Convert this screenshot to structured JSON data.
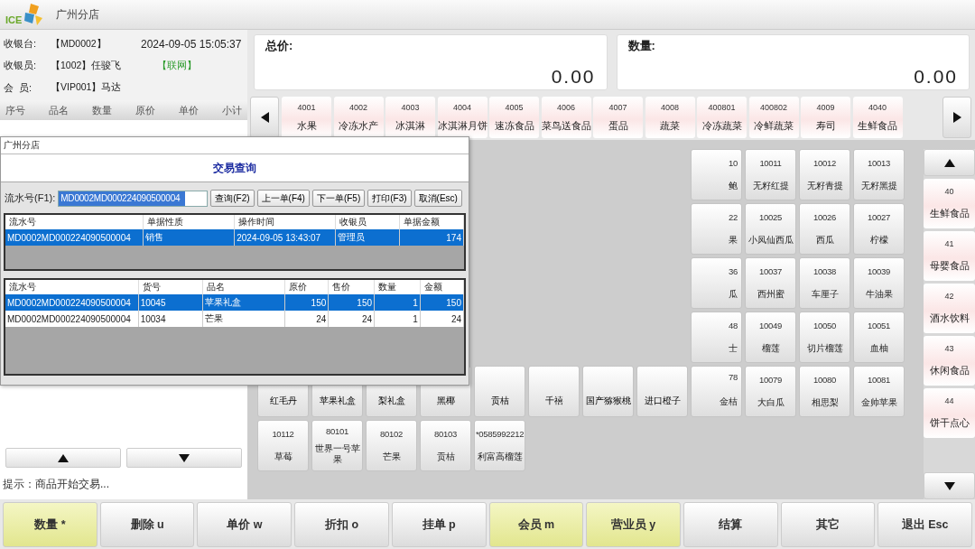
{
  "app": {
    "logo_text": "ICE",
    "store": "广州分店"
  },
  "info": {
    "register_label": "收银台:",
    "register": "【MD0002】",
    "datetime": "2024-09-05 15:05:37",
    "cashier_label": "收银员:",
    "cashier": "【1002】任骏飞",
    "network": "【联网】",
    "member_label": "会  员:",
    "member": "【VIP001】马达"
  },
  "cart_columns": [
    "序号",
    "品名",
    "数量",
    "原价",
    "单价",
    "小计"
  ],
  "hint": "提示：商品开始交易...",
  "totals": [
    {
      "label": "总价:",
      "value": "0.00"
    },
    {
      "label": "数量:",
      "value": "0.00"
    }
  ],
  "categories": [
    {
      "code": "4001",
      "name": "水果"
    },
    {
      "code": "4002",
      "name": "冷冻水产"
    },
    {
      "code": "4003",
      "name": "冰淇淋"
    },
    {
      "code": "4004",
      "name": "冰淇淋月饼"
    },
    {
      "code": "4005",
      "name": "速冻食品"
    },
    {
      "code": "4006",
      "name": "菜鸟送食品"
    },
    {
      "code": "4007",
      "name": "蛋品"
    },
    {
      "code": "4008",
      "name": "蔬菜"
    },
    {
      "code": "400801",
      "name": "冷冻蔬菜"
    },
    {
      "code": "400802",
      "name": "冷鲜蔬菜"
    },
    {
      "code": "4009",
      "name": "寿司"
    },
    {
      "code": "4040",
      "name": "生鲜食品"
    }
  ],
  "side_categories": [
    {
      "code": "40",
      "name": "生鲜食品"
    },
    {
      "code": "41",
      "name": "母婴食品"
    },
    {
      "code": "42",
      "name": "酒水饮料"
    },
    {
      "code": "43",
      "name": "休闲食品"
    },
    {
      "code": "44",
      "name": "饼干点心"
    }
  ],
  "product_rows": [
    [
      {
        "kind": "hidden"
      },
      {
        "kind": "hidden"
      },
      {
        "kind": "hidden"
      },
      {
        "kind": "hidden"
      },
      {
        "kind": "hidden"
      },
      {
        "kind": "hidden"
      },
      {
        "kind": "hidden"
      },
      {
        "kind": "hidden"
      },
      {
        "kind": "partial",
        "code": "10",
        "name": "鲍"
      },
      {
        "kind": "full",
        "code": "10011",
        "name": "无籽红提"
      },
      {
        "kind": "full",
        "code": "10012",
        "name": "无籽青提"
      },
      {
        "kind": "full",
        "code": "10013",
        "name": "无籽黑提"
      }
    ],
    [
      {
        "kind": "hidden"
      },
      {
        "kind": "hidden"
      },
      {
        "kind": "hidden"
      },
      {
        "kind": "hidden"
      },
      {
        "kind": "hidden"
      },
      {
        "kind": "hidden"
      },
      {
        "kind": "hidden"
      },
      {
        "kind": "hidden"
      },
      {
        "kind": "partial",
        "code": "22",
        "name": "果"
      },
      {
        "kind": "full",
        "code": "10025",
        "name": "小凤仙西瓜"
      },
      {
        "kind": "full",
        "code": "10026",
        "name": "西瓜"
      },
      {
        "kind": "full",
        "code": "10027",
        "name": "柠檬"
      }
    ],
    [
      {
        "kind": "hidden"
      },
      {
        "kind": "hidden"
      },
      {
        "kind": "hidden"
      },
      {
        "kind": "hidden"
      },
      {
        "kind": "hidden"
      },
      {
        "kind": "hidden"
      },
      {
        "kind": "hidden"
      },
      {
        "kind": "hidden"
      },
      {
        "kind": "partial",
        "code": "36",
        "name": "瓜"
      },
      {
        "kind": "full",
        "code": "10037",
        "name": "西州蜜"
      },
      {
        "kind": "full",
        "code": "10038",
        "name": "车厘子"
      },
      {
        "kind": "full",
        "code": "10039",
        "name": "牛油果"
      }
    ],
    [
      {
        "kind": "hidden"
      },
      {
        "kind": "hidden"
      },
      {
        "kind": "hidden"
      },
      {
        "kind": "hidden"
      },
      {
        "kind": "hidden"
      },
      {
        "kind": "hidden"
      },
      {
        "kind": "hidden"
      },
      {
        "kind": "hidden"
      },
      {
        "kind": "partial",
        "code": "48",
        "name": "士"
      },
      {
        "kind": "full",
        "code": "10049",
        "name": "榴莲"
      },
      {
        "kind": "full",
        "code": "10050",
        "name": "切片榴莲"
      },
      {
        "kind": "full",
        "code": "10051",
        "name": "血柚"
      }
    ],
    [
      {
        "kind": "lower",
        "name": "红毛丹"
      },
      {
        "kind": "lower",
        "name": "苹果礼盒"
      },
      {
        "kind": "lower",
        "name": "梨礼盒"
      },
      {
        "kind": "lower",
        "name": "黑椰"
      },
      {
        "kind": "lower",
        "name": "贡桔"
      },
      {
        "kind": "lower",
        "name": "千禧"
      },
      {
        "kind": "lower",
        "name": "国产猕猴桃"
      },
      {
        "kind": "lower",
        "name": "进口橙子"
      },
      {
        "kind": "lowerpartial",
        "code": "78",
        "name": "金桔"
      },
      {
        "kind": "full",
        "code": "10079",
        "name": "大白瓜"
      },
      {
        "kind": "full",
        "code": "10080",
        "name": "相思梨"
      },
      {
        "kind": "full",
        "code": "10081",
        "name": "金帅苹果"
      }
    ],
    [
      {
        "kind": "full",
        "code": "10112",
        "name": "草莓"
      },
      {
        "kind": "full",
        "code": "80101",
        "name": "世界一号苹果"
      },
      {
        "kind": "full",
        "code": "80102",
        "name": "芒果"
      },
      {
        "kind": "full",
        "code": "80103",
        "name": "贡桔"
      },
      {
        "kind": "full",
        "code": "*0585992212",
        "name": "利富高榴莲"
      }
    ]
  ],
  "dialog": {
    "window_title": "广州分店",
    "title": "交易查询",
    "serial_label": "流水号(F1):",
    "serial_value": "MD0002MD000224090500004",
    "buttons": [
      "查询(F2)",
      "上一单(F4)",
      "下一单(F5)",
      "打印(F3)",
      "取消(Esc)"
    ],
    "orders": {
      "columns": [
        {
          "label": "流水号",
          "kind": "text"
        },
        {
          "label": "单据性质",
          "kind": "text"
        },
        {
          "label": "操作时间",
          "kind": "text"
        },
        {
          "label": "收银员",
          "kind": "text"
        },
        {
          "label": "单据金额",
          "kind": "number"
        }
      ],
      "rows": [
        {
          "selected": true,
          "cells": [
            "MD0002MD000224090500004",
            "销售",
            "2024-09-05 13:43:07",
            "管理员",
            "174"
          ]
        }
      ]
    },
    "items": {
      "columns": [
        {
          "label": "流水号",
          "kind": "text"
        },
        {
          "label": "货号",
          "kind": "text"
        },
        {
          "label": "品名",
          "kind": "text"
        },
        {
          "label": "原价",
          "kind": "number"
        },
        {
          "label": "售价",
          "kind": "number"
        },
        {
          "label": "数量",
          "kind": "number"
        },
        {
          "label": "金额",
          "kind": "number"
        }
      ],
      "rows": [
        {
          "selected": true,
          "cells": [
            "MD0002MD000224090500004",
            "10045",
            "苹果礼盒",
            "150",
            "150",
            "1",
            "150"
          ]
        },
        {
          "selected": false,
          "cells": [
            "MD0002MD000224090500004",
            "10034",
            "芒果",
            "24",
            "24",
            "1",
            "24"
          ]
        }
      ]
    }
  },
  "function_keys": [
    {
      "label": "数量 *",
      "highlighted": true
    },
    {
      "label": "删除 u",
      "highlighted": false
    },
    {
      "label": "单价 w",
      "highlighted": false
    },
    {
      "label": "折扣 o",
      "highlighted": false
    },
    {
      "label": "挂单 p",
      "highlighted": false
    },
    {
      "label": "会员 m",
      "highlighted": true
    },
    {
      "label": "营业员 y",
      "highlighted": true
    },
    {
      "label": "结算",
      "highlighted": false
    },
    {
      "label": "其它",
      "highlighted": false
    },
    {
      "label": "退出 Esc",
      "highlighted": false
    }
  ]
}
